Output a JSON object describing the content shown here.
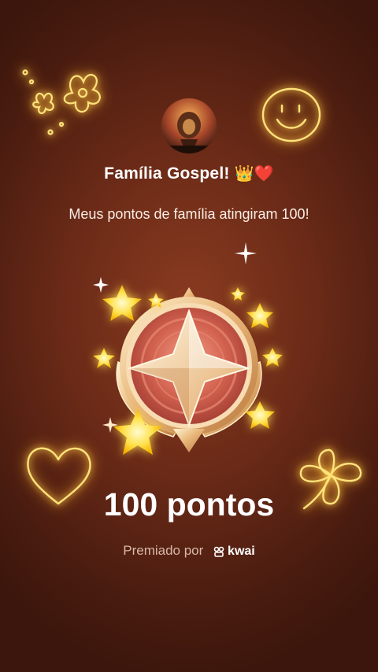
{
  "profile": {
    "avatar_name": "lion-avatar",
    "family_name": "Família Gospel!",
    "title_emojis": [
      "👑",
      "❤️"
    ]
  },
  "message": "Meus pontos de família atingiram 100!",
  "achievement": {
    "points_label": "100 pontos",
    "points": 100,
    "medal_icon": "star-medal-icon"
  },
  "footer": {
    "awarded_by": "Premiado por",
    "brand": "kwai",
    "brand_icon": "kwai-logo-icon"
  },
  "decorations": [
    "flower-doodle-icon",
    "smiley-doodle-icon",
    "heart-doodle-icon",
    "clover-doodle-icon",
    "star-icon"
  ],
  "colors": {
    "background": "#6a2a17",
    "glow": "#ffd25a",
    "medal_red": "#c8584a",
    "medal_gold": "#f0c98a"
  }
}
